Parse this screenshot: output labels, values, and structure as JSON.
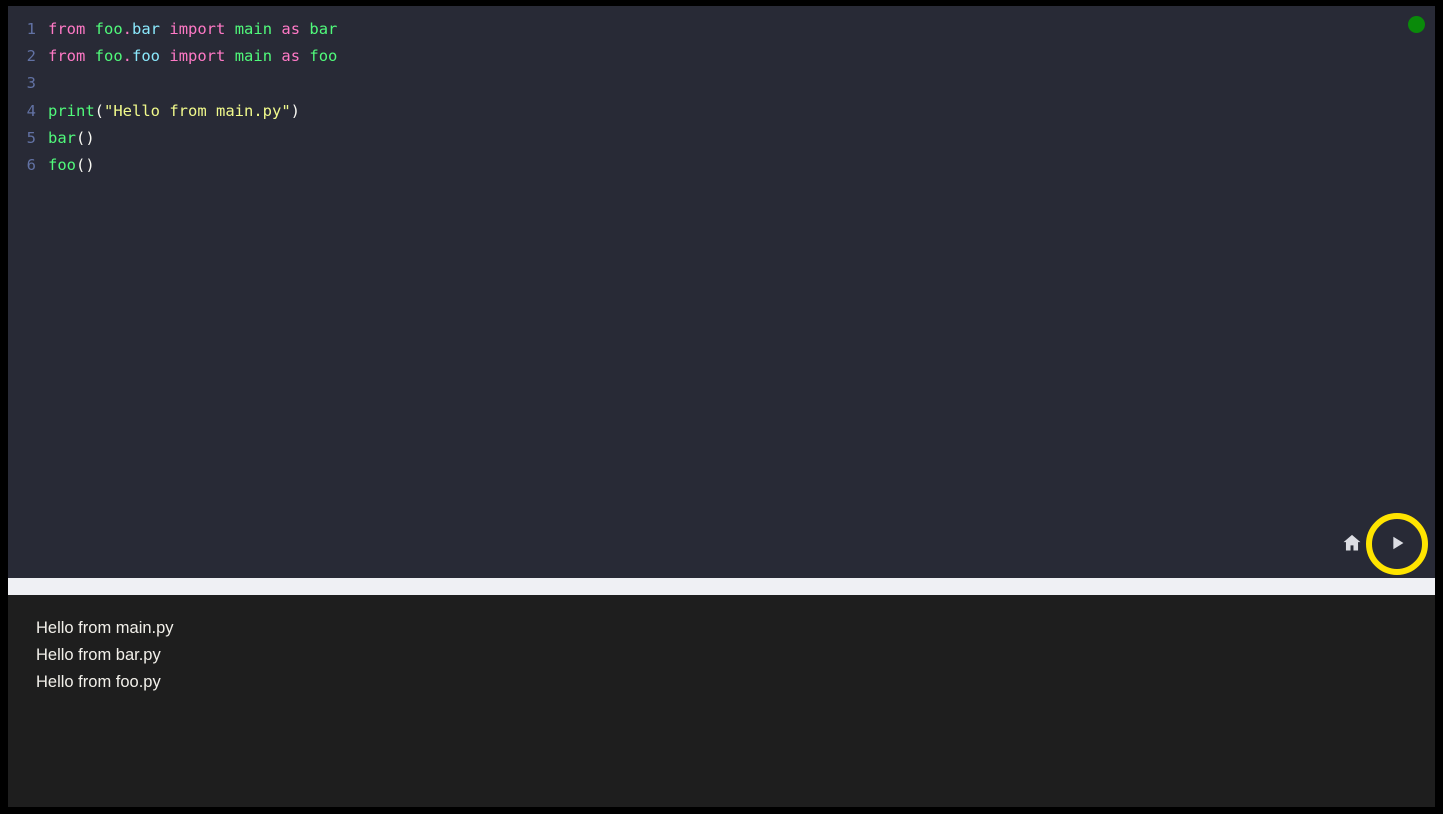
{
  "window": {
    "status_indicator": "green-status-dot",
    "status_color": "#0a8a0a"
  },
  "editor": {
    "language": "python",
    "theme": "dracula",
    "background_color": "#282a36",
    "gutter_color": "#6272a4",
    "lines": [
      {
        "number": "1",
        "text": "from foo.bar import main as bar",
        "tokens": [
          {
            "t": "from",
            "c": "kw"
          },
          {
            "t": " ",
            "c": "punc"
          },
          {
            "t": "foo",
            "c": "name"
          },
          {
            "t": ".",
            "c": "dot"
          },
          {
            "t": "bar",
            "c": "attr"
          },
          {
            "t": " ",
            "c": "punc"
          },
          {
            "t": "import",
            "c": "kw"
          },
          {
            "t": " ",
            "c": "punc"
          },
          {
            "t": "main",
            "c": "name"
          },
          {
            "t": " ",
            "c": "punc"
          },
          {
            "t": "as",
            "c": "kw"
          },
          {
            "t": " ",
            "c": "punc"
          },
          {
            "t": "bar",
            "c": "name"
          }
        ]
      },
      {
        "number": "2",
        "text": "from foo.foo import main as foo",
        "tokens": [
          {
            "t": "from",
            "c": "kw"
          },
          {
            "t": " ",
            "c": "punc"
          },
          {
            "t": "foo",
            "c": "name"
          },
          {
            "t": ".",
            "c": "dot"
          },
          {
            "t": "foo",
            "c": "attr"
          },
          {
            "t": " ",
            "c": "punc"
          },
          {
            "t": "import",
            "c": "kw"
          },
          {
            "t": " ",
            "c": "punc"
          },
          {
            "t": "main",
            "c": "name"
          },
          {
            "t": " ",
            "c": "punc"
          },
          {
            "t": "as",
            "c": "kw"
          },
          {
            "t": " ",
            "c": "punc"
          },
          {
            "t": "foo",
            "c": "name"
          }
        ]
      },
      {
        "number": "3",
        "text": "",
        "tokens": []
      },
      {
        "number": "4",
        "text": "print(\"Hello from main.py\")",
        "tokens": [
          {
            "t": "print",
            "c": "fn"
          },
          {
            "t": "(",
            "c": "punc"
          },
          {
            "t": "\"Hello from main.py\"",
            "c": "str"
          },
          {
            "t": ")",
            "c": "punc"
          }
        ]
      },
      {
        "number": "5",
        "text": "bar()",
        "tokens": [
          {
            "t": "bar",
            "c": "fn"
          },
          {
            "t": "()",
            "c": "punc"
          }
        ]
      },
      {
        "number": "6",
        "text": "foo()",
        "tokens": [
          {
            "t": "foo",
            "c": "fn"
          },
          {
            "t": "()",
            "c": "punc"
          }
        ]
      }
    ]
  },
  "controls": {
    "home_icon": "home-icon",
    "home_label": "Home",
    "run_icon": "play-icon",
    "run_label": "Run",
    "run_highlight_color": "#ffe400"
  },
  "console": {
    "background_color": "#1e1e1e",
    "text_color": "#f2f0ea",
    "output_lines": [
      "Hello from main.py",
      "Hello from bar.py",
      "Hello from foo.py"
    ]
  }
}
